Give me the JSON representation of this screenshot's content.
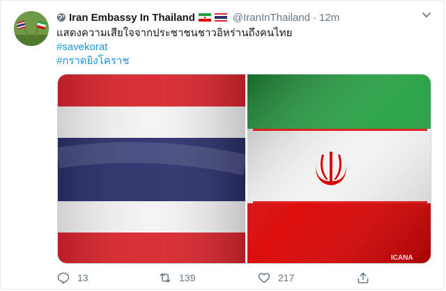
{
  "tweet": {
    "display_name": "Iran Embassy In Thailand",
    "handle": "@IranInThailand",
    "separator": "·",
    "time": "12m",
    "text_line": "แสดงความเสียใจจากประชาชนชาวอิหร่านถึงคนไทย",
    "hashtags": [
      "#savekorat",
      "#กราดยิงโคราช"
    ],
    "media_watermark": "ICANA"
  },
  "actions": {
    "reply_count": "13",
    "retweet_count": "139",
    "like_count": "217"
  },
  "colors": {
    "link": "#1b95e0",
    "muted": "#657786",
    "thai_red": "#d9252c",
    "thai_blue": "#2b2f6b",
    "iran_green": "#239f40",
    "iran_red": "#da0000"
  },
  "icons": [
    "globe-icon",
    "iran-flag-icon",
    "thailand-flag-icon",
    "chevron-down-icon",
    "reply-icon",
    "retweet-icon",
    "like-icon",
    "share-icon"
  ]
}
